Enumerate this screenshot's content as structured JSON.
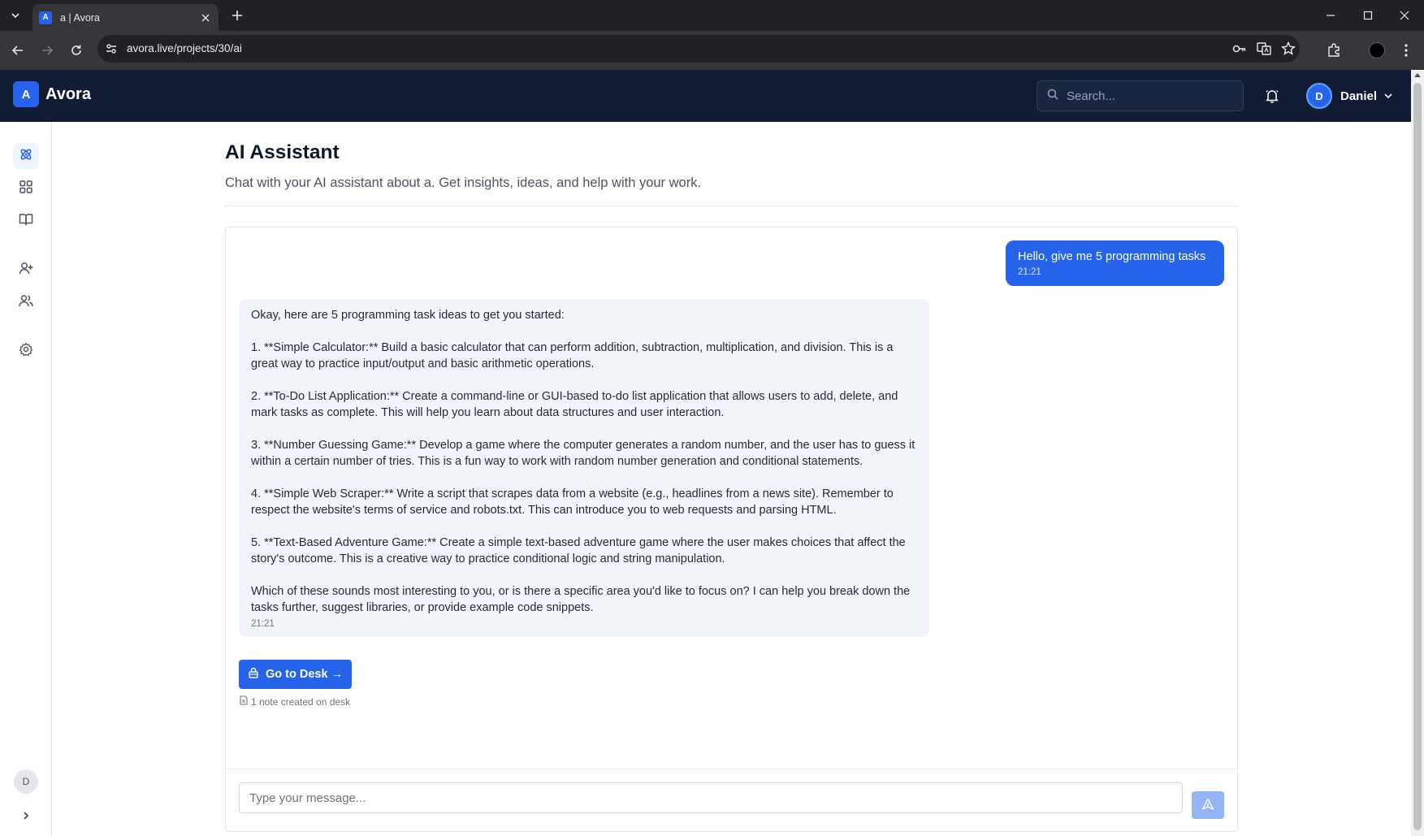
{
  "browser": {
    "tab_title": "a | Avora",
    "favicon_letter": "A",
    "url": "avora.live/projects/30/ai"
  },
  "header": {
    "logo_letter": "A",
    "brand": "Avora",
    "search_placeholder": "Search...",
    "user_initial": "D",
    "user_name": "Daniel"
  },
  "sidebar": {
    "items": [
      {
        "icon": "atom-icon",
        "active": true
      },
      {
        "icon": "dashboard-grid-icon",
        "active": false
      },
      {
        "icon": "book-open-icon",
        "active": false
      },
      {
        "icon": "user-plus-icon",
        "active": false
      },
      {
        "icon": "users-icon",
        "active": false
      },
      {
        "icon": "settings-gear-icon",
        "active": false
      }
    ],
    "avatar_initial": "D"
  },
  "page": {
    "title": "AI Assistant",
    "subtitle": "Chat with your AI assistant about a. Get insights, ideas, and help with your work."
  },
  "chat": {
    "user_message": {
      "text": "Hello, give me 5 programming tasks",
      "time": "21:21"
    },
    "ai_message": {
      "paragraphs": [
        "Okay, here are 5 programming task ideas to get you started:",
        "1.  **Simple Calculator:** Build a basic calculator that can perform addition, subtraction, multiplication, and division. This is a great way to practice input/output and basic arithmetic operations.",
        "2.  **To-Do List Application:** Create a command-line or GUI-based to-do list application that allows users to add, delete, and mark tasks as complete. This will help you learn about data structures and user interaction.",
        "3.  **Number Guessing Game:** Develop a game where the computer generates a random number, and the user has to guess it within a certain number of tries. This is a fun way to work with random number generation and conditional statements.",
        "4.  **Simple Web Scraper:** Write a script that scrapes data from a website (e.g., headlines from a news site). Remember to respect the website's terms of service and robots.txt. This can introduce you to web requests and parsing HTML.",
        "5.  **Text-Based Adventure Game:** Create a simple text-based adventure game where the user makes choices that affect the story's outcome. This is a creative way to practice conditional logic and string manipulation.",
        "Which of these sounds most interesting to you, or is there a specific area you'd like to focus on? I can help you break down the tasks further, suggest libraries, or provide example code snippets."
      ],
      "time": "21:21"
    },
    "desk_button_label": "Go to Desk →",
    "desk_note": "1 note created on desk",
    "input_placeholder": "Type your message..."
  },
  "colors": {
    "primary": "#2563eb",
    "header_bg": "#111b34",
    "ai_bubble_bg": "#f1f5f9"
  }
}
